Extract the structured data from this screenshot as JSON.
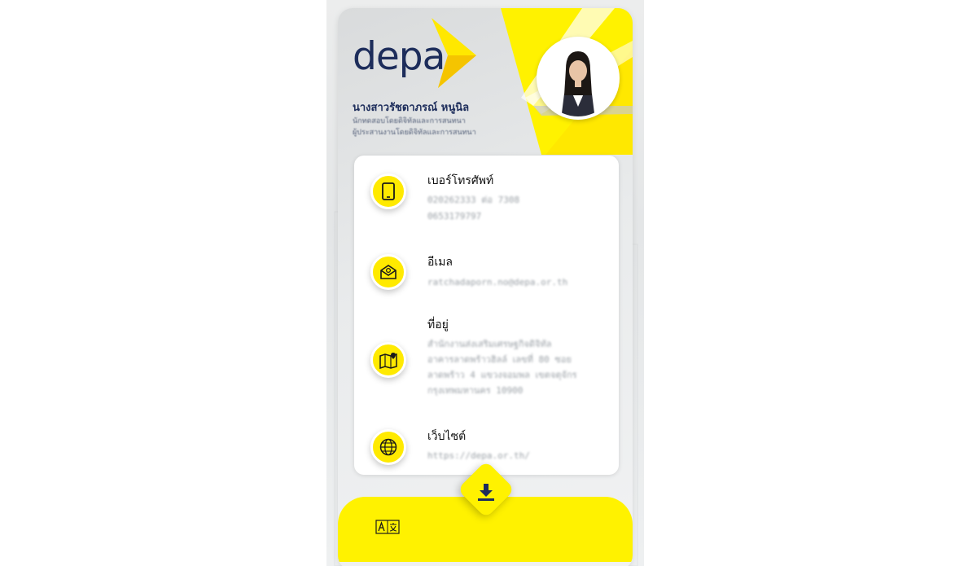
{
  "brand": {
    "logo_text": "depa",
    "accent": "#fff200",
    "navy": "#1d2d5b"
  },
  "profile": {
    "name": "นางสาวรัชดาภรณ์ หนูนิล",
    "role_line1": "นักทดสอบโดยดิจิทัลและการสนทนา",
    "role_line2": "ผู้ประสานงานโดยดิจิทัลและการสนทนา"
  },
  "contacts": [
    {
      "icon": "smartphone-icon",
      "label": "เบอร์โทรศัพท์",
      "values": [
        "020262333 ต่อ 7308",
        "0653179797"
      ]
    },
    {
      "icon": "email-icon",
      "label": "อีเมล",
      "values": [
        "ratchadaporn.no@depa.or.th"
      ]
    },
    {
      "icon": "map-pin-icon",
      "label": "ที่อยู่",
      "values": [
        "สำนักงานส่งเสริมเศรษฐกิจดิจิทัล",
        "อาคารลาดพร้าวฮิลล์ เลขที่ 80 ซอย",
        "ลาดพร้าว 4 แขวงจอมพล เขตจตุจักร",
        "กรุงเทพมหานคร 10900"
      ]
    },
    {
      "icon": "globe-icon",
      "label": "เว็บไซต์",
      "values": [
        "https://depa.or.th/"
      ]
    }
  ],
  "actions": {
    "download_icon": "download-icon",
    "translate_icon": "translate-icon"
  }
}
